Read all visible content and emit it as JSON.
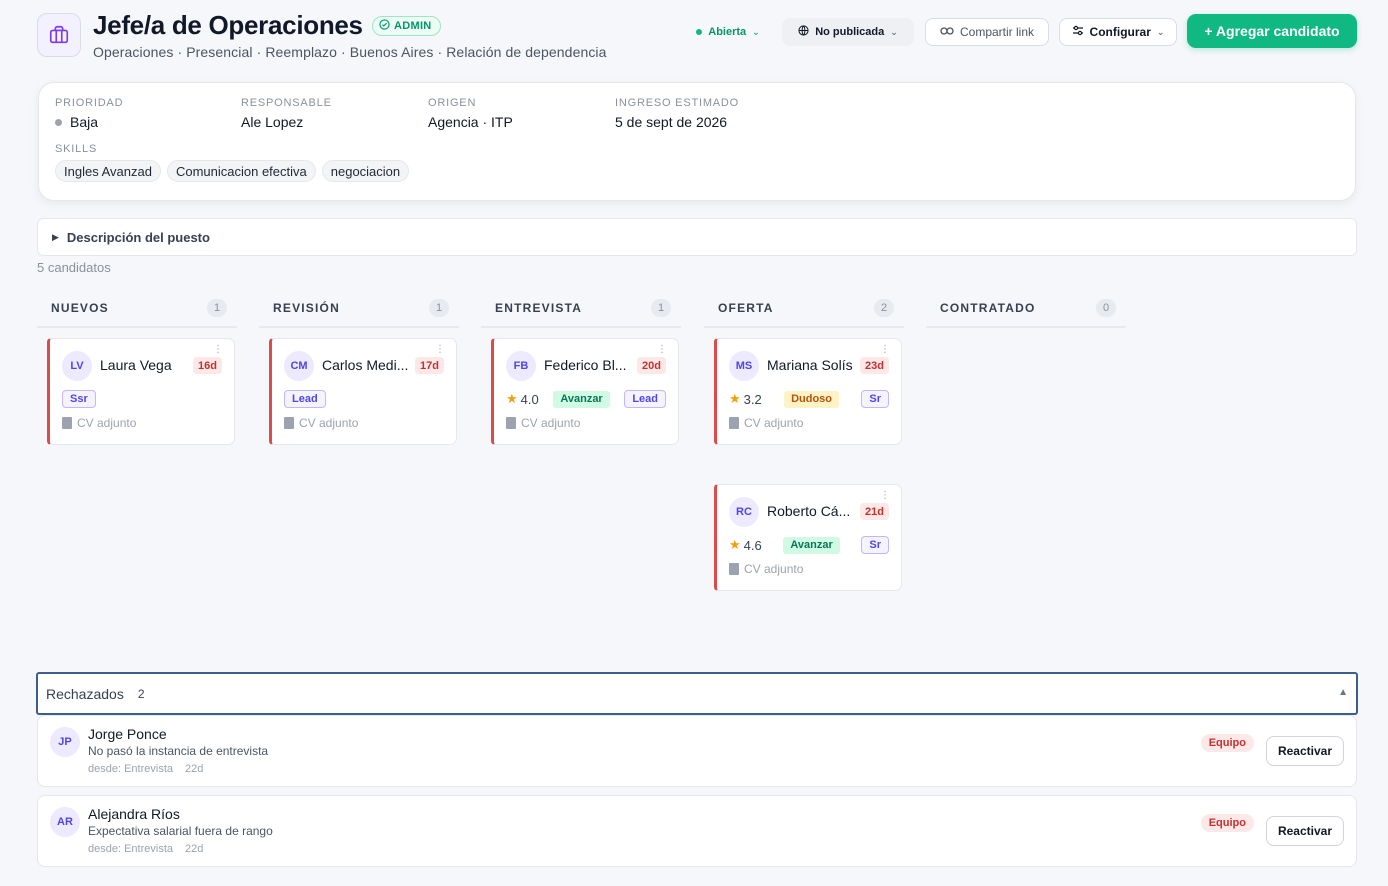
{
  "header": {
    "title": "Jefe/a de Operaciones",
    "badge": "ADMIN",
    "subtitle": "Operaciones · Presencial · Reemplazo · Buenos Aires · Relación de dependencia",
    "status_label": "Abierta",
    "publish_label": "No publicada",
    "share_label": "Compartir link",
    "config_label": "Configurar",
    "add_label": "+ Agregar candidato"
  },
  "info": {
    "priority_label": "PRIORIDAD",
    "priority_value": "Baja",
    "owner_label": "RESPONSABLE",
    "owner_value": "Ale Lopez",
    "origin_label": "ORIGEN",
    "origin_value": "Agencia · ITP",
    "start_label": "INGRESO ESTIMADO",
    "start_value": "5 de sept de 2026",
    "skills_label": "SKILLS",
    "skills": [
      "Ingles Avanzad",
      "Comunicacion efectiva",
      "negociacion"
    ]
  },
  "description": {
    "label": "Descripción del puesto"
  },
  "candidates_count": "5 candidatos",
  "columns": [
    {
      "title": "NUEVOS",
      "count": "1",
      "cards": [
        {
          "initials": "LV",
          "name": "Laura Vega",
          "days": "16d",
          "rating": "",
          "recommendation": "",
          "level": "Ssr",
          "cv": "CV adjunto"
        }
      ]
    },
    {
      "title": "REVISIÓN",
      "count": "1",
      "cards": [
        {
          "initials": "CM",
          "name": "Carlos Medi...",
          "days": "17d",
          "rating": "",
          "recommendation": "",
          "level": "Lead",
          "cv": "CV adjunto"
        }
      ]
    },
    {
      "title": "ENTREVISTA",
      "count": "1",
      "cards": [
        {
          "initials": "FB",
          "name": "Federico Bl...",
          "days": "20d",
          "rating": "4.0",
          "recommendation": "Avanzar",
          "level": "Lead",
          "cv": "CV adjunto"
        }
      ]
    },
    {
      "title": "OFERTA",
      "count": "2",
      "cards": [
        {
          "initials": "MS",
          "name": "Mariana Solís",
          "days": "23d",
          "rating": "3.2",
          "recommendation": "Dudoso",
          "level": "Sr",
          "cv": "CV adjunto"
        },
        {
          "initials": "RC",
          "name": "Roberto Cá...",
          "days": "21d",
          "rating": "4.6",
          "recommendation": "Avanzar",
          "level": "Sr",
          "cv": "CV adjunto"
        }
      ]
    },
    {
      "title": "CONTRATADO",
      "count": "0",
      "cards": []
    }
  ],
  "rejected": {
    "label": "Rechazados",
    "count": "2",
    "items": [
      {
        "initials": "JP",
        "name": "Jorge Ponce",
        "reason": "No pasó la instancia de entrevista",
        "since": "desde: Entrevista",
        "days": "22d",
        "tag": "Equipo",
        "action": "Reactivar"
      },
      {
        "initials": "AR",
        "name": "Alejandra Ríos",
        "reason": "Expectativa salarial fuera de rango",
        "since": "desde: Entrevista",
        "days": "22d",
        "tag": "Equipo",
        "action": "Reactivar"
      }
    ]
  },
  "colors": {
    "accent": "#10b981",
    "card_border": "#dc4b4b",
    "avatar_bg": "#ede9fe",
    "avatar_text": "#4f46e5"
  }
}
